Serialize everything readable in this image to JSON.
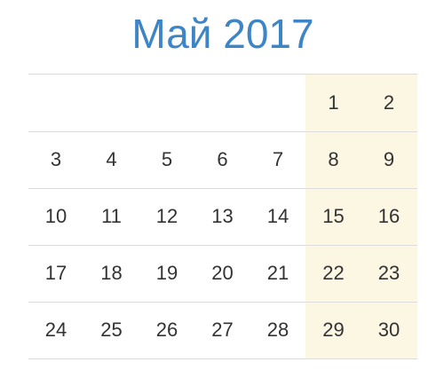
{
  "calendar": {
    "title": "Май 2017",
    "colors": {
      "title": "#3d85c6",
      "weekend_background": "#fcf7e3",
      "day_text": "#333333",
      "grid_line": "#dcdcdc"
    },
    "weeks": [
      [
        "",
        "",
        "",
        "",
        "",
        "1",
        "2"
      ],
      [
        "3",
        "4",
        "5",
        "6",
        "7",
        "8",
        "9"
      ],
      [
        "10",
        "11",
        "12",
        "13",
        "14",
        "15",
        "16"
      ],
      [
        "17",
        "18",
        "19",
        "20",
        "21",
        "22",
        "23"
      ],
      [
        "24",
        "25",
        "26",
        "27",
        "28",
        "29",
        "30"
      ]
    ]
  }
}
